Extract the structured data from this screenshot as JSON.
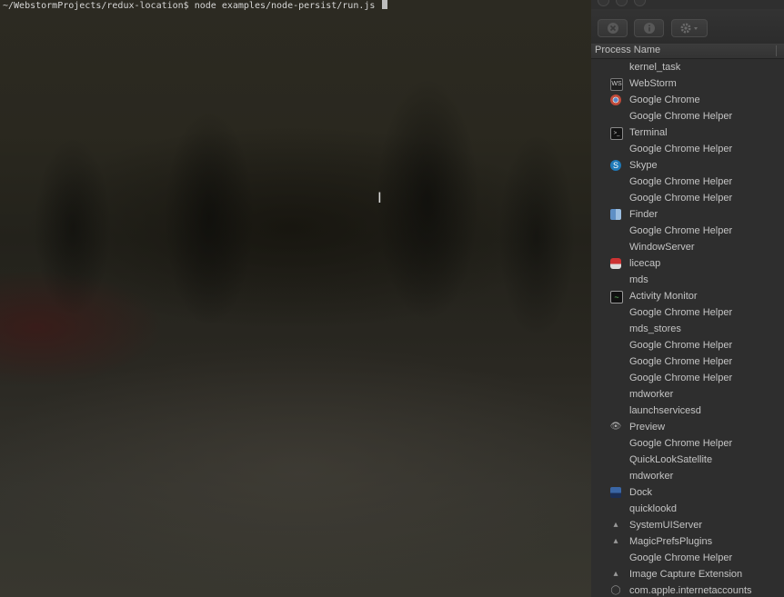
{
  "terminal": {
    "prompt": "~/WebstormProjects/redux-location$ node examples/node-persist/run.js "
  },
  "activity_monitor": {
    "column_header": "Process Name",
    "processes": [
      {
        "name": "kernel_task",
        "icon": ""
      },
      {
        "name": "WebStorm",
        "icon": "webstorm-icon"
      },
      {
        "name": "Google Chrome",
        "icon": "chrome-icon"
      },
      {
        "name": "Google Chrome Helper",
        "icon": ""
      },
      {
        "name": "Terminal",
        "icon": "terminal-icon"
      },
      {
        "name": "Google Chrome Helper",
        "icon": ""
      },
      {
        "name": "Skype",
        "icon": "skype-icon"
      },
      {
        "name": "Google Chrome Helper",
        "icon": ""
      },
      {
        "name": "Google Chrome Helper",
        "icon": ""
      },
      {
        "name": "Finder",
        "icon": "finder-icon"
      },
      {
        "name": "Google Chrome Helper",
        "icon": ""
      },
      {
        "name": "WindowServer",
        "icon": ""
      },
      {
        "name": "licecap",
        "icon": "licecap-icon"
      },
      {
        "name": "mds",
        "icon": ""
      },
      {
        "name": "Activity Monitor",
        "icon": "activity-monitor-icon"
      },
      {
        "name": "Google Chrome Helper",
        "icon": ""
      },
      {
        "name": "mds_stores",
        "icon": ""
      },
      {
        "name": "Google Chrome Helper",
        "icon": ""
      },
      {
        "name": "Google Chrome Helper",
        "icon": ""
      },
      {
        "name": "Google Chrome Helper",
        "icon": ""
      },
      {
        "name": "mdworker",
        "icon": ""
      },
      {
        "name": "launchservicesd",
        "icon": ""
      },
      {
        "name": "Preview",
        "icon": "preview-icon"
      },
      {
        "name": "Google Chrome Helper",
        "icon": ""
      },
      {
        "name": "QuickLookSatellite",
        "icon": ""
      },
      {
        "name": "mdworker",
        "icon": ""
      },
      {
        "name": "Dock",
        "icon": "dock-icon"
      },
      {
        "name": "quicklookd",
        "icon": ""
      },
      {
        "name": "SystemUIServer",
        "icon": "systemuiserver-icon"
      },
      {
        "name": "MagicPrefsPlugins",
        "icon": "magicprefs-icon"
      },
      {
        "name": "Google Chrome Helper",
        "icon": ""
      },
      {
        "name": "Image Capture Extension",
        "icon": "image-capture-icon"
      },
      {
        "name": "com.apple.internetaccounts",
        "icon": "internet-accounts-icon"
      }
    ]
  },
  "colors": {
    "terminal_text": "#d6d6d6",
    "monitor_bg": "#2e2e2e",
    "row_text": "#c4c4c4"
  }
}
